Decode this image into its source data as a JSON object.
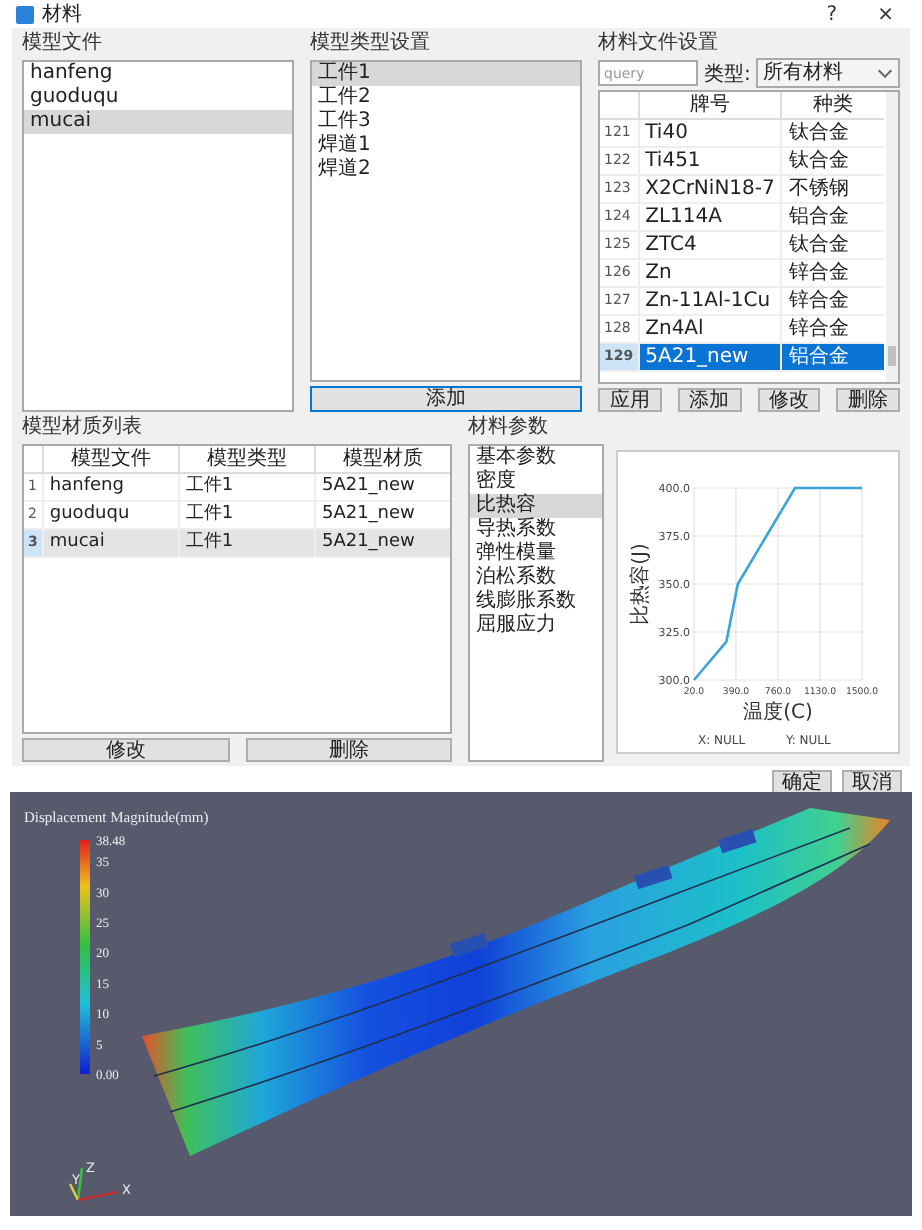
{
  "window": {
    "title": "材料",
    "help": "?",
    "close": "×"
  },
  "model_files": {
    "title": "模型文件",
    "items": [
      {
        "label": "hanfeng",
        "selected": false
      },
      {
        "label": "guoduqu",
        "selected": false
      },
      {
        "label": "mucai",
        "selected": true
      }
    ]
  },
  "model_types": {
    "title": "模型类型设置",
    "items": [
      {
        "label": "工件1",
        "selected": true
      },
      {
        "label": "工件2",
        "selected": false
      },
      {
        "label": "工件3",
        "selected": false
      },
      {
        "label": "焊道1",
        "selected": false
      },
      {
        "label": "焊道2",
        "selected": false
      }
    ],
    "button": "添加"
  },
  "material_files": {
    "title": "材料文件设置",
    "search": {
      "placeholder": "query"
    },
    "type_label": "类型:",
    "type_value": "所有材料",
    "columns": [
      "牌号",
      "种类"
    ],
    "rows": [
      {
        "index": "121",
        "cells": [
          "Ti40",
          "钛合金"
        ],
        "selected": false
      },
      {
        "index": "122",
        "cells": [
          "Ti451",
          "钛合金"
        ],
        "selected": false
      },
      {
        "index": "123",
        "cells": [
          "X2CrNiN18-7",
          "不锈钢"
        ],
        "selected": false
      },
      {
        "index": "124",
        "cells": [
          "ZL114A",
          "铝合金"
        ],
        "selected": false
      },
      {
        "index": "125",
        "cells": [
          "ZTC4",
          "钛合金"
        ],
        "selected": false
      },
      {
        "index": "126",
        "cells": [
          "Zn",
          "锌合金"
        ],
        "selected": false
      },
      {
        "index": "127",
        "cells": [
          "Zn-11Al-1Cu",
          "锌合金"
        ],
        "selected": false
      },
      {
        "index": "128",
        "cells": [
          "Zn4Al",
          "锌合金"
        ],
        "selected": false
      },
      {
        "index": "129",
        "cells": [
          "5A21_new",
          "铝合金"
        ],
        "selected": true
      }
    ],
    "buttons": [
      "应用",
      "添加",
      "修改",
      "删除"
    ]
  },
  "assignments": {
    "title": "模型材质列表",
    "columns": [
      "模型文件",
      "模型类型",
      "模型材质"
    ],
    "rows": [
      {
        "index": "1",
        "cells": [
          "hanfeng",
          "工件1",
          "5A21_new"
        ],
        "selected": false
      },
      {
        "index": "2",
        "cells": [
          "guoduqu",
          "工件1",
          "5A21_new"
        ],
        "selected": false
      },
      {
        "index": "3",
        "cells": [
          "mucai",
          "工件1",
          "5A21_new"
        ],
        "selected": true
      }
    ],
    "buttons": [
      "修改",
      "删除"
    ]
  },
  "material_params": {
    "title": "材料参数",
    "items": [
      {
        "label": "基本参数",
        "selected": false
      },
      {
        "label": "密度",
        "selected": false
      },
      {
        "label": "比热容",
        "selected": true
      },
      {
        "label": "导热系数",
        "selected": false
      },
      {
        "label": "弹性模量",
        "selected": false
      },
      {
        "label": "泊松系数",
        "selected": false
      },
      {
        "label": "线膨胀系数",
        "selected": false
      },
      {
        "label": "屈服应力",
        "selected": false
      }
    ],
    "chart_data": {
      "type": "line",
      "xlabel": "温度(C)",
      "ylabel": "比热容(J)",
      "x": [
        20,
        305,
        405,
        910,
        1500
      ],
      "grid": true,
      "series": [
        {
          "color": "#3aa6d8",
          "values": [
            300,
            320,
            350,
            400,
            400
          ]
        }
      ],
      "xlim": [
        20,
        1500
      ],
      "ylim": [
        300,
        400
      ],
      "xticks": [
        {
          "value": 20,
          "label": "20.0"
        },
        {
          "value": 390,
          "label": "390.0"
        },
        {
          "value": 760,
          "label": "760.0"
        },
        {
          "value": 1130,
          "label": "1130.0"
        },
        {
          "value": 1500,
          "label": "1500.0"
        }
      ],
      "yticks": [
        {
          "value": 300,
          "label": "300.0"
        },
        {
          "value": 325,
          "label": "325.0"
        },
        {
          "value": 350,
          "label": "350.0"
        },
        {
          "value": 375,
          "label": "375.0"
        },
        {
          "value": 400,
          "label": "400.0"
        }
      ]
    },
    "legend": [
      "X: NULL",
      "Y: NULL"
    ]
  },
  "dialog_buttons": [
    "确定",
    "取消"
  ],
  "viewport": {
    "colorbar": {
      "title": "Displacement Magnitude(mm)",
      "ticks": [
        "38.48",
        "35",
        "30",
        "25",
        "20",
        "15",
        "10",
        "5",
        "0.00"
      ]
    },
    "axes": [
      "Z",
      "Y",
      "X"
    ]
  }
}
